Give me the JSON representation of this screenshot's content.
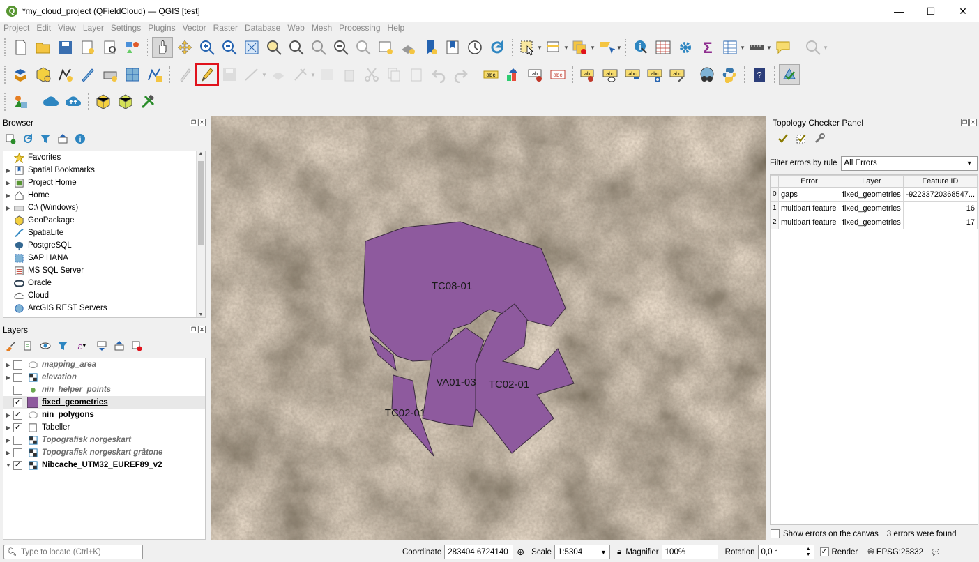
{
  "window": {
    "title": "*my_cloud_project (QFieldCloud) — QGIS [test]",
    "logo": "Q",
    "minimize": "—",
    "maximize": "☐",
    "close": "✕"
  },
  "menu": [
    "Project",
    "Edit",
    "View",
    "Layer",
    "Settings",
    "Plugins",
    "Vector",
    "Raster",
    "Database",
    "Web",
    "Mesh",
    "Processing",
    "Help"
  ],
  "browser": {
    "title": "Browser",
    "items": [
      {
        "label": "Favorites",
        "icon": "star-icon",
        "expand": ""
      },
      {
        "label": "Spatial Bookmarks",
        "icon": "bookmark-icon",
        "expand": "▶"
      },
      {
        "label": "Project Home",
        "icon": "project-home-icon",
        "expand": "▶"
      },
      {
        "label": "Home",
        "icon": "home-icon",
        "expand": "▶"
      },
      {
        "label": "C:\\ (Windows)",
        "icon": "drive-icon",
        "expand": "▶"
      },
      {
        "label": "GeoPackage",
        "icon": "geopackage-icon",
        "expand": ""
      },
      {
        "label": "SpatiaLite",
        "icon": "spatialite-icon",
        "expand": ""
      },
      {
        "label": "PostgreSQL",
        "icon": "postgresql-icon",
        "expand": ""
      },
      {
        "label": "SAP HANA",
        "icon": "sap-hana-icon",
        "expand": ""
      },
      {
        "label": "MS SQL Server",
        "icon": "mssql-icon",
        "expand": ""
      },
      {
        "label": "Oracle",
        "icon": "oracle-icon",
        "expand": ""
      },
      {
        "label": "Cloud",
        "icon": "cloud-icon",
        "expand": ""
      },
      {
        "label": "ArcGIS REST Servers",
        "icon": "arcgis-icon",
        "expand": ""
      }
    ]
  },
  "layers": {
    "title": "Layers",
    "items": [
      {
        "label": "mapping_area",
        "checked": false,
        "style": "it",
        "icon": "polygon-layer-icon",
        "expand": "▶"
      },
      {
        "label": "elevation",
        "checked": false,
        "style": "it",
        "icon": "raster-layer-icon",
        "expand": "▶"
      },
      {
        "label": "nin_helper_points",
        "checked": false,
        "style": "it",
        "icon": "point-layer-icon",
        "expand": ""
      },
      {
        "label": "fixed_geometries",
        "checked": true,
        "style": "bd",
        "icon": "purple-fill-icon",
        "expand": "",
        "selected": true
      },
      {
        "label": "nin_polygons",
        "checked": true,
        "style": "bd",
        "icon": "polygon-layer-icon",
        "expand": "▶"
      },
      {
        "label": "Tabeller",
        "checked": true,
        "style": "",
        "icon": "group-icon",
        "expand": "▶"
      },
      {
        "label": "Topografisk norgeskart",
        "checked": false,
        "style": "it",
        "icon": "raster-layer-icon",
        "expand": "▶"
      },
      {
        "label": "Topografisk norgeskart gråtone",
        "checked": false,
        "style": "it",
        "icon": "raster-layer-icon",
        "expand": "▶"
      },
      {
        "label": "Nibcache_UTM32_EUREF89_v2",
        "checked": true,
        "style": "bd",
        "icon": "raster-layer-icon",
        "expand": "▼"
      }
    ]
  },
  "map": {
    "labels": {
      "tc08": "TC08-01",
      "va01": "VA01-03",
      "tc02a": "TC02-01",
      "tc02b": "TC02-01"
    },
    "polygon_fill": "#8e5a9e"
  },
  "topology": {
    "title": "Topology Checker Panel",
    "filter_label": "Filter errors by rule",
    "filter_value": "All Errors",
    "columns": [
      "Error",
      "Layer",
      "Feature ID"
    ],
    "rows": [
      {
        "idx": "0",
        "error": "gaps",
        "layer": "fixed_geometries",
        "fid": "-92233720368547..."
      },
      {
        "idx": "1",
        "error": "multipart feature",
        "layer": "fixed_geometries",
        "fid": "16"
      },
      {
        "idx": "2",
        "error": "multipart feature",
        "layer": "fixed_geometries",
        "fid": "17"
      }
    ],
    "show_errors_label": "Show errors on the canvas",
    "found": "3 errors were found"
  },
  "status": {
    "locate_placeholder": "Type to locate (Ctrl+K)",
    "coordinate_label": "Coordinate",
    "coordinate": "283404  6724140",
    "scale_label": "Scale",
    "scale": "1:5304",
    "magnifier_label": "Magnifier",
    "magnifier": "100%",
    "rotation_label": "Rotation",
    "rotation": "0,0 °",
    "render_label": "Render",
    "crs": "EPSG:25832"
  }
}
